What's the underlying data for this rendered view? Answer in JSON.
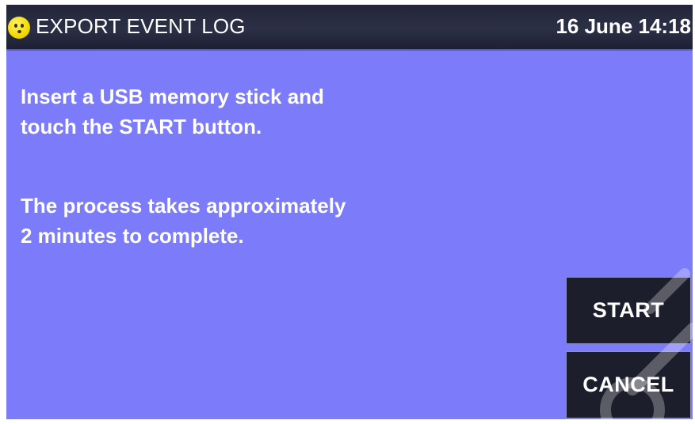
{
  "header": {
    "title": "EXPORT EVENT LOG",
    "datetime": "16 June 14:18",
    "status_icon": "smiley-face-icon"
  },
  "message": {
    "line1": "Insert a USB memory stick and",
    "line2": "touch the START button.",
    "line3": "The process takes approximately",
    "line4": "2 minutes to complete."
  },
  "buttons": {
    "start_label": "START",
    "cancel_label": "CANCEL"
  },
  "colors": {
    "screen_background": "#7c7cfb",
    "titlebar_background": "#2c3046",
    "button_background": "#1c1e2c",
    "text": "#ffffff",
    "status_icon": "#f3d900"
  }
}
